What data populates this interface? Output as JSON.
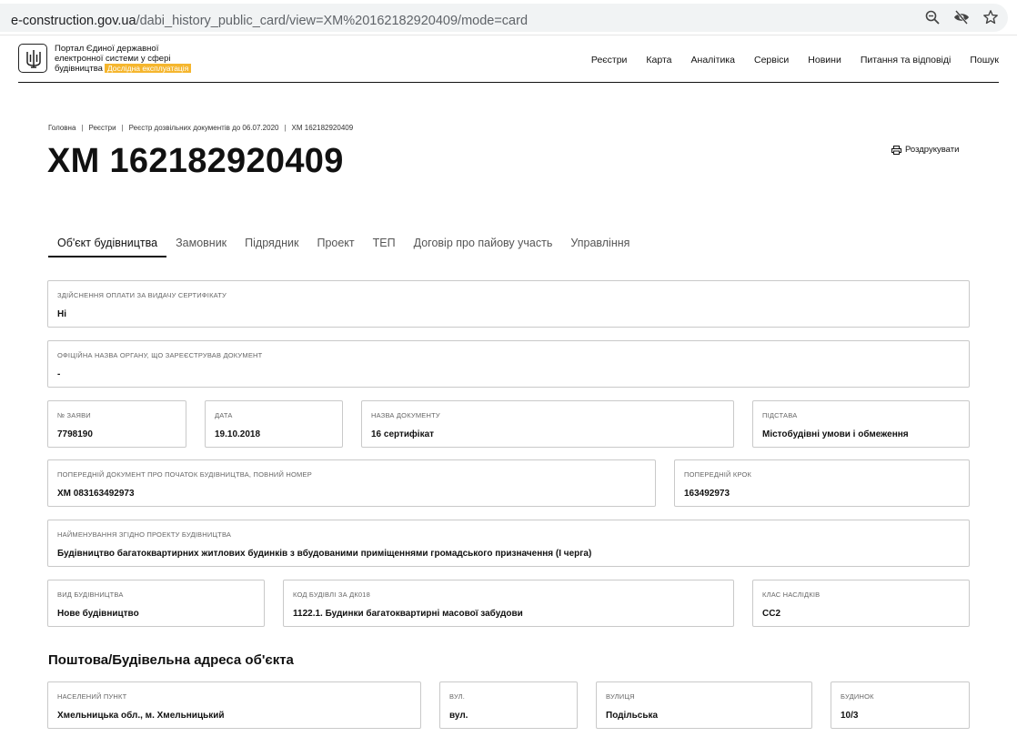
{
  "browser": {
    "url_host": "e-construction.gov.ua",
    "url_path": "/dabi_history_public_card/view=ХМ%20162182920409/mode=card"
  },
  "header": {
    "brand_line1": "Портал Єдиної державної",
    "brand_line2": "електронної системи у сфері",
    "brand_line3": "будівництва",
    "badge": "Дослідна експлуатація",
    "nav": [
      "Реєстри",
      "Карта",
      "Аналітика",
      "Сервіси",
      "Новини",
      "Питання та відповіді",
      "Пошук"
    ]
  },
  "breadcrumb": [
    "Головна",
    "Реєстри",
    "Реєстр дозвільних документів до 06.07.2020",
    "ХМ 162182920409"
  ],
  "page": {
    "title": "ХМ 162182920409",
    "print_label": "Роздрукувати"
  },
  "tabs": [
    "Об'єкт будівництва",
    "Замовник",
    "Підрядник",
    "Проект",
    "ТЕП",
    "Договір про пайову участь",
    "Управління"
  ],
  "fields": {
    "payment": {
      "label": "Здійснення оплати за видачу сертифікату",
      "value": "Ні"
    },
    "authority": {
      "label": "Офіційна назва органу, що зареєстрував документ",
      "value": "-"
    },
    "application_no": {
      "label": "№ заяви",
      "value": "7798190"
    },
    "date": {
      "label": "Дата",
      "value": "19.10.2018"
    },
    "doc_name": {
      "label": "Назва документу",
      "value": "16 сертифікат"
    },
    "basis": {
      "label": "Підстава",
      "value": "Містобудівні умови і обмеження"
    },
    "prev_doc": {
      "label": "Попередній документ про початок будівництва, повний номер",
      "value": "ХМ 083163492973"
    },
    "prev_step": {
      "label": "Попередній крок",
      "value": "163492973"
    },
    "project_name": {
      "label": "Найменування згідно проекту будівництва",
      "value": "Будівництво багатоквартирних житлових будинків з вбудованими приміщеннями громадського призначення (І черга)"
    },
    "construction_type": {
      "label": "Вид будівництва",
      "value": "Нове будівництво"
    },
    "building_code": {
      "label": "Код будівлі за ДК018",
      "value": "1122.1. Будинки багатоквартирні масової забудови"
    },
    "consequence_class": {
      "label": "Клас наслідків",
      "value": "СС2"
    }
  },
  "address": {
    "title": "Поштова/Будівельна адреса об'єкта",
    "locality": {
      "label": "Населений пункт",
      "value": "Хмельницька обл., м. Хмельницький"
    },
    "street_type": {
      "label": "Вул.",
      "value": "вул."
    },
    "street": {
      "label": "Вулиця",
      "value": "Подільська"
    },
    "building": {
      "label": "Будинок",
      "value": "10/3"
    }
  }
}
